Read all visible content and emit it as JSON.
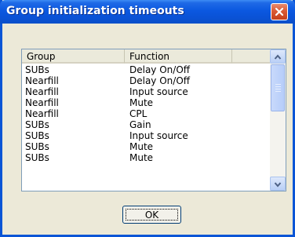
{
  "window": {
    "title": "Group initialization timeouts"
  },
  "list": {
    "columns": [
      "Group",
      "Function",
      ""
    ],
    "rows": [
      {
        "group": "SUBs",
        "function": "Delay On/Off"
      },
      {
        "group": "Nearfill",
        "function": "Delay On/Off"
      },
      {
        "group": "Nearfill",
        "function": "Input source"
      },
      {
        "group": "Nearfill",
        "function": "Mute"
      },
      {
        "group": "Nearfill",
        "function": "CPL"
      },
      {
        "group": "SUBs",
        "function": "Gain"
      },
      {
        "group": "SUBs",
        "function": "Input source"
      },
      {
        "group": "SUBs",
        "function": "Mute"
      },
      {
        "group": "SUBs",
        "function": "Mute"
      }
    ]
  },
  "buttons": {
    "ok_label": "OK"
  },
  "icons": {
    "close": "close-icon",
    "scroll_up": "arrow-up-icon",
    "scroll_down": "arrow-down-icon"
  },
  "colors": {
    "titlebar": "#0a55d6",
    "close_button": "#db5a34",
    "dialog_background": "#ece9d8"
  }
}
